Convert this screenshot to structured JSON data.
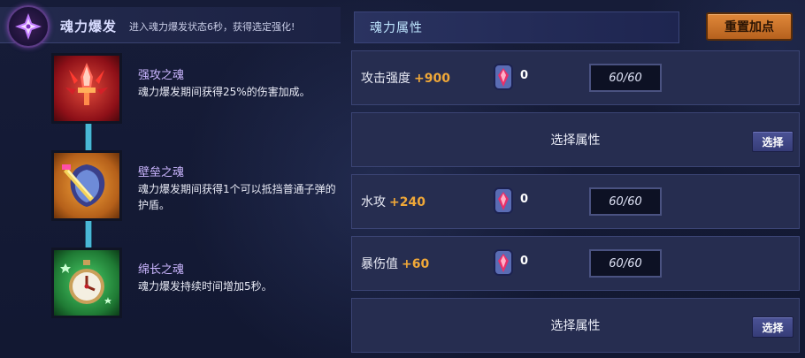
{
  "left": {
    "title": "魂力爆发",
    "description": "进入魂力爆发状态6秒，获得选定强化!",
    "souls": [
      {
        "name": "强攻之魂",
        "description": "魂力爆发期间获得25%的伤害加成。",
        "icon": "flame-sword-icon",
        "color": "#c2202a"
      },
      {
        "name": "壁垒之魂",
        "description": "魂力爆发期间获得1个可以抵挡普通子弹的护盾。",
        "icon": "shield-icon",
        "color": "#e08a2a"
      },
      {
        "name": "绵长之魂",
        "description": "魂力爆发持续时间增加5秒。",
        "icon": "stopwatch-icon",
        "color": "#2fa24a"
      }
    ]
  },
  "right": {
    "title": "魂力属性",
    "reset_label": "重置加点",
    "rows": [
      {
        "type": "stat",
        "label": "攻击强度",
        "bonus": "+900",
        "gem_count": "0",
        "value": "60/60"
      },
      {
        "type": "select",
        "label": "选择属性",
        "button": "选择"
      },
      {
        "type": "stat",
        "label": "水攻",
        "bonus": "+240",
        "gem_count": "0",
        "value": "60/60"
      },
      {
        "type": "stat",
        "label": "暴伤值",
        "bonus": "+60",
        "gem_count": "0",
        "value": "60/60"
      },
      {
        "type": "select",
        "label": "选择属性",
        "button": "选择"
      }
    ]
  },
  "colors": {
    "accent_orange": "#f0a838",
    "connector": "#4ab7d6",
    "soul_name": "#cbb6ff"
  }
}
